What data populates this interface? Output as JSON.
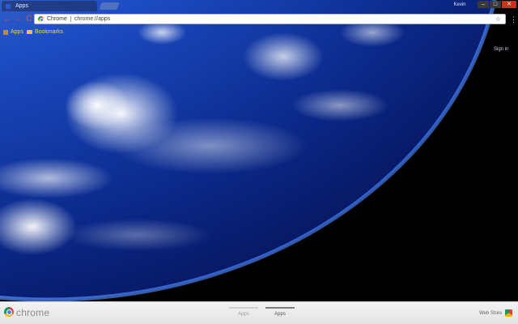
{
  "tab": {
    "title": "Apps"
  },
  "window": {
    "user": "Kevin",
    "minimize": "–",
    "maximize": "□",
    "close": "✕"
  },
  "toolbar": {
    "back": "←",
    "forward": "→",
    "reload": "C",
    "omnibox_chip": "Chrome",
    "url": "chrome://apps",
    "star": "☆",
    "menu": "⋮"
  },
  "bookmarks": {
    "items": [
      {
        "label": "Apps",
        "icon": "apps-grid-icon"
      },
      {
        "label": "Bookmarks",
        "icon": "folder-icon"
      }
    ]
  },
  "ntp": {
    "signin": "Sign in"
  },
  "footer": {
    "brand": "chrome",
    "pages": [
      {
        "label": "Apps",
        "selected": false
      },
      {
        "label": "Apps",
        "selected": true
      }
    ],
    "webstore": "Web Store"
  },
  "colors": {
    "accent_orange": "#e24a2f",
    "bookmark_yellow": "#f2d64e",
    "close_red": "#c2351f",
    "footer_bg": "#e9e9e9"
  }
}
